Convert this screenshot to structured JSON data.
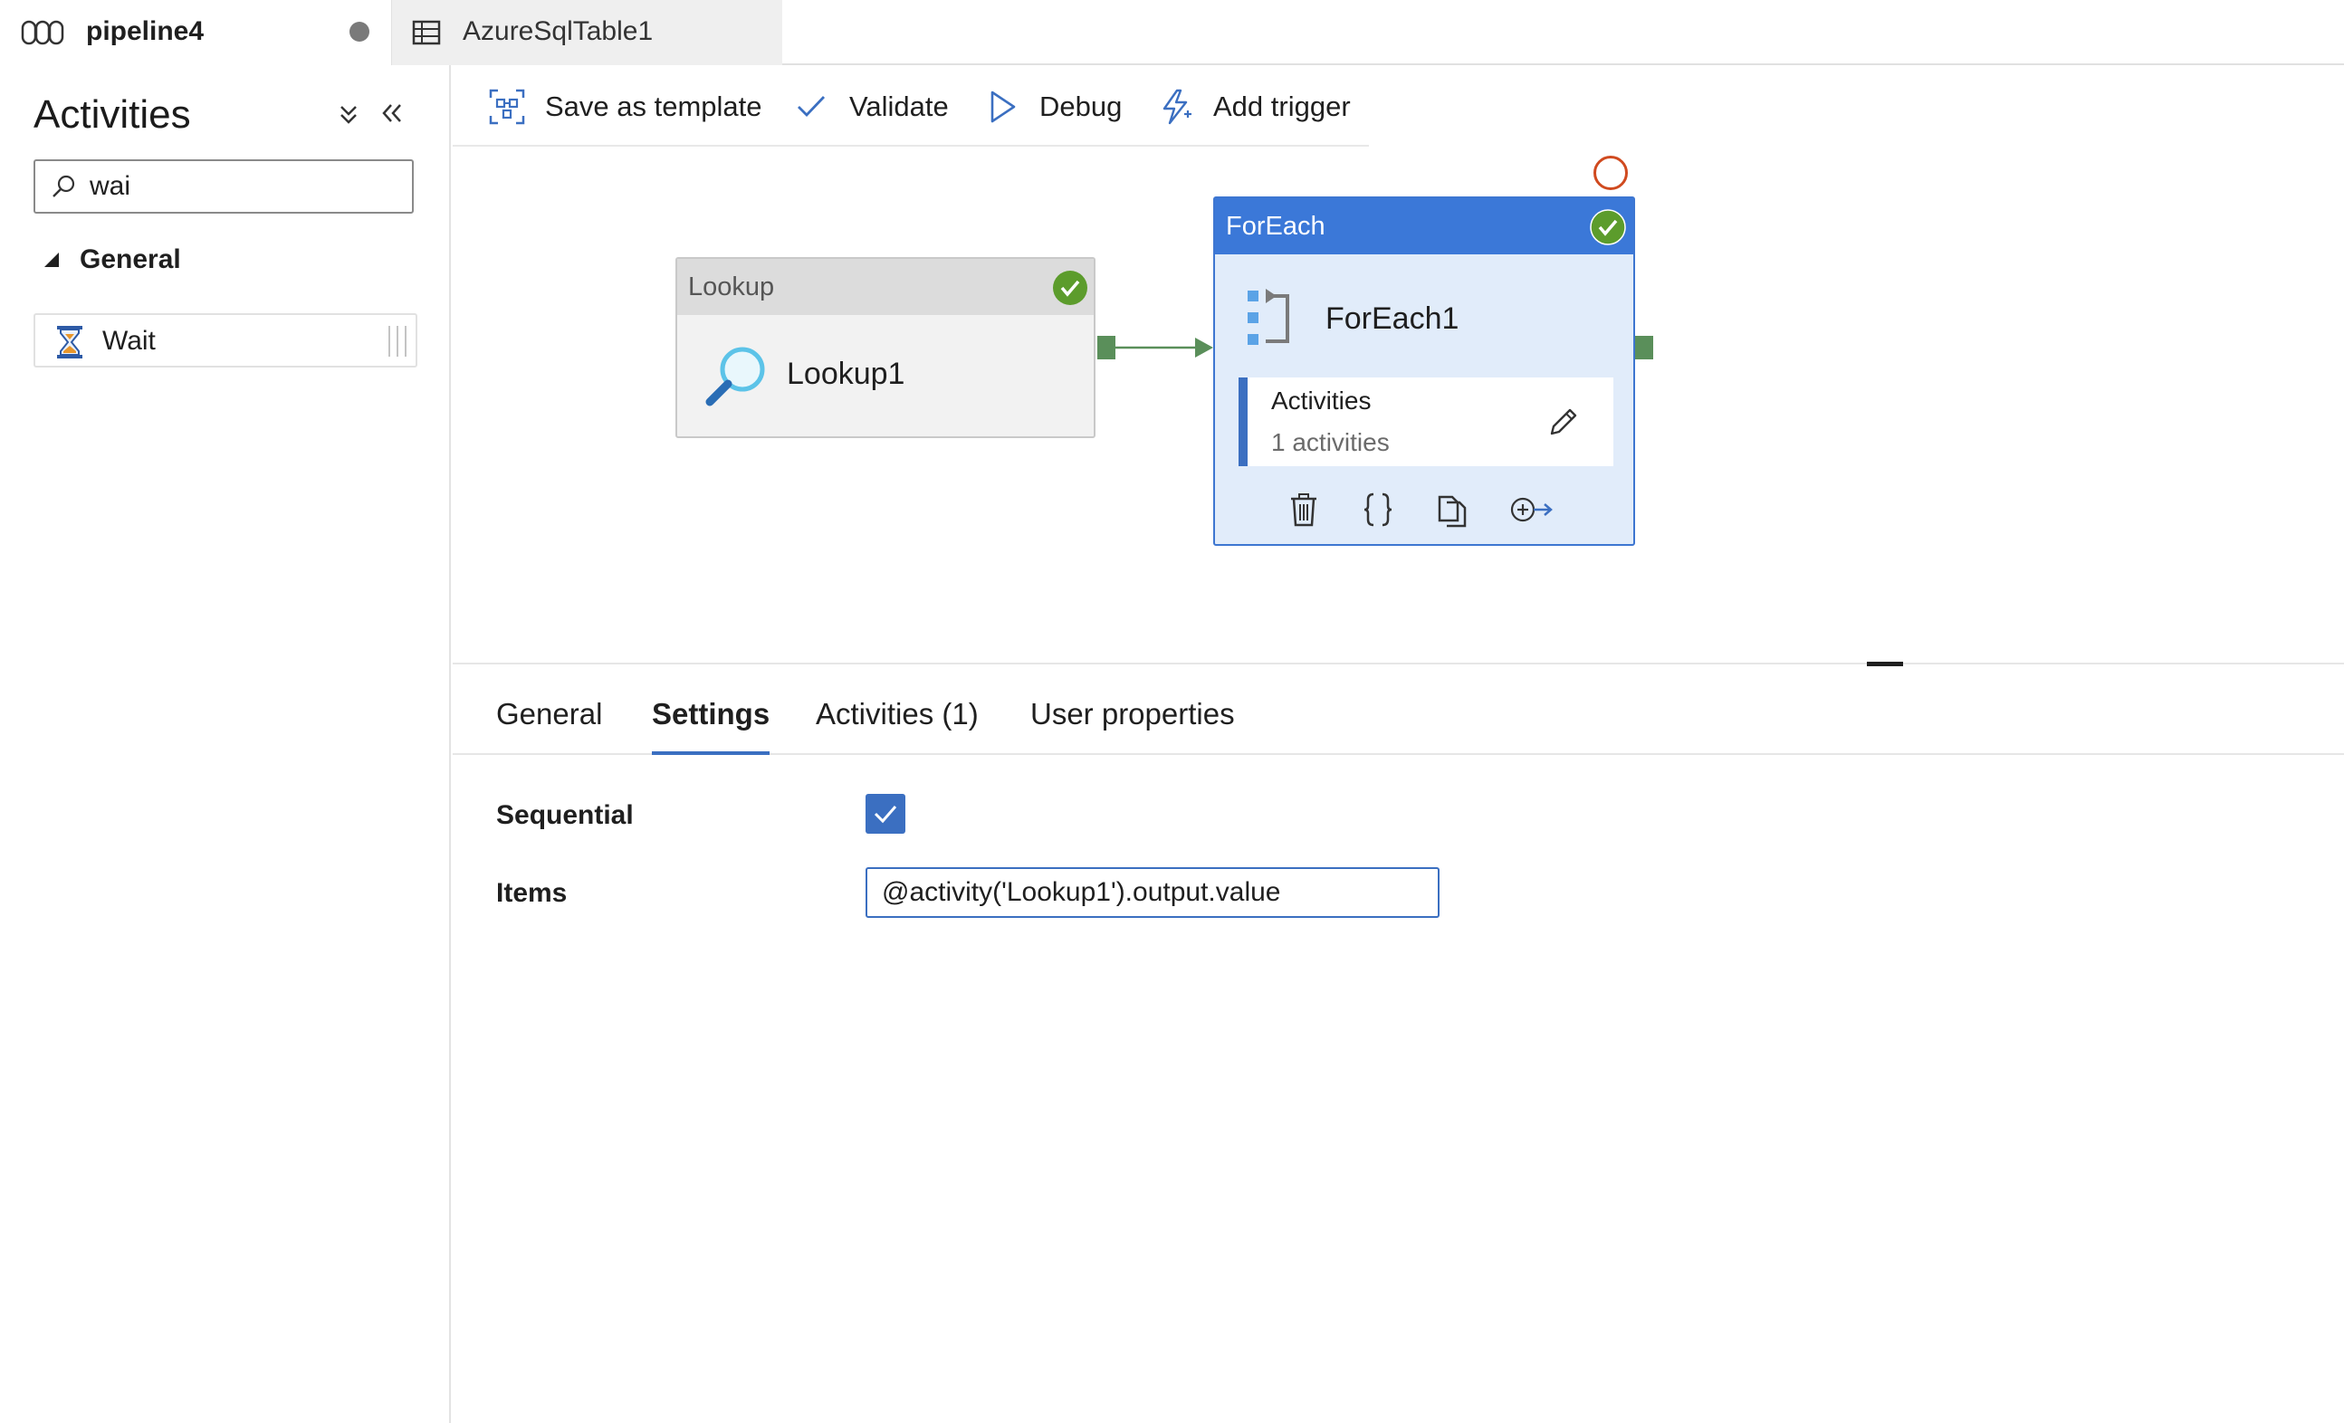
{
  "tabs": {
    "pipeline": {
      "label": "pipeline4",
      "icon": "pipeline-icon",
      "dirty": true
    },
    "dataset": {
      "label": "AzureSqlTable1",
      "icon": "table-icon"
    }
  },
  "activities_pane": {
    "title": "Activities",
    "search": {
      "value": "wai",
      "placeholder": "Search activities"
    },
    "group": {
      "label": "General",
      "expanded": true
    },
    "items": [
      {
        "label": "Wait",
        "icon": "hourglass-icon"
      }
    ]
  },
  "toolbar": {
    "save_template": "Save as template",
    "validate": "Validate",
    "debug": "Debug",
    "add_trigger": "Add trigger"
  },
  "canvas": {
    "lookup": {
      "type": "Lookup",
      "name": "Lookup1",
      "status": "succeeded"
    },
    "foreach": {
      "type": "ForEach",
      "name": "ForEach1",
      "status": "succeeded",
      "inner_title": "Activities",
      "inner_count": "1 activities"
    }
  },
  "properties": {
    "tabs": [
      "General",
      "Settings",
      "Activities (1)",
      "User properties"
    ],
    "selected_tab": "Settings",
    "sequential_label": "Sequential",
    "sequential_checked": true,
    "items_label": "Items",
    "items_value": "@activity('Lookup1').output.value"
  },
  "colors": {
    "accent": "#3b6fc1",
    "foreach_header": "#3b78d8",
    "success": "#5c9c2c",
    "connector": "#5a8f5a",
    "breakpoint": "#d04a1f"
  }
}
